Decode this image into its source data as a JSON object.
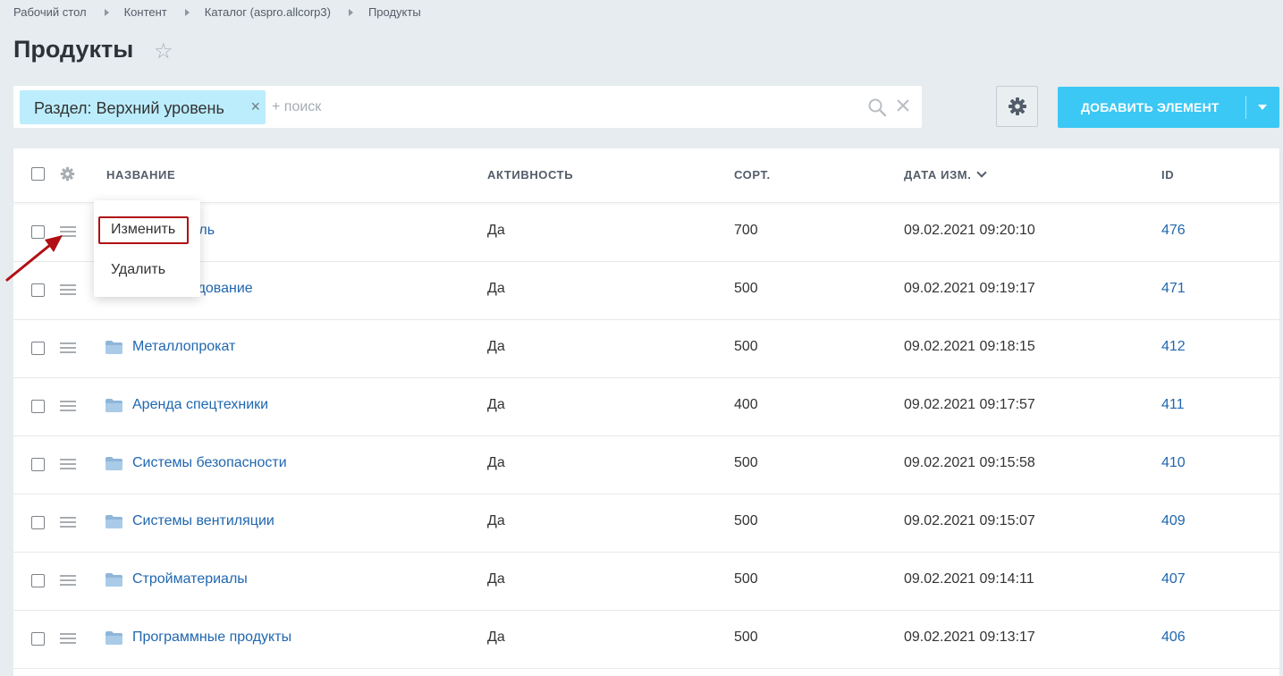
{
  "breadcrumbs": [
    "Рабочий стол",
    "Контент",
    "Каталог (aspro.allcorp3)",
    "Продукты"
  ],
  "page_title": "Продукты",
  "filter": {
    "chip_label": "Раздел: Верхний уровень",
    "search_placeholder": "+ поиск"
  },
  "toolbar": {
    "add_label": "ДОБАВИТЬ ЭЛЕМЕНТ"
  },
  "columns": {
    "name": "НАЗВАНИЕ",
    "active": "АКТИВНОСТЬ",
    "sort": "СОРТ.",
    "date": "ДАТА ИЗМ.",
    "id": "ID"
  },
  "rows": [
    {
      "name": "ская мебель",
      "active": "Да",
      "sort": "700",
      "date": "09.02.2021 09:20:10",
      "id": "476",
      "folder": false
    },
    {
      "name": "кое оборудование",
      "active": "Да",
      "sort": "500",
      "date": "09.02.2021 09:19:17",
      "id": "471",
      "folder": false
    },
    {
      "name": "Металлопрокат",
      "active": "Да",
      "sort": "500",
      "date": "09.02.2021 09:18:15",
      "id": "412",
      "folder": true
    },
    {
      "name": "Аренда спецтехники",
      "active": "Да",
      "sort": "400",
      "date": "09.02.2021 09:17:57",
      "id": "411",
      "folder": true
    },
    {
      "name": "Системы безопасности",
      "active": "Да",
      "sort": "500",
      "date": "09.02.2021 09:15:58",
      "id": "410",
      "folder": true
    },
    {
      "name": "Системы вентиляции",
      "active": "Да",
      "sort": "500",
      "date": "09.02.2021 09:15:07",
      "id": "409",
      "folder": true
    },
    {
      "name": "Стройматериалы",
      "active": "Да",
      "sort": "500",
      "date": "09.02.2021 09:14:11",
      "id": "407",
      "folder": true
    },
    {
      "name": "Программные продукты",
      "active": "Да",
      "sort": "500",
      "date": "09.02.2021 09:13:17",
      "id": "406",
      "folder": true
    }
  ],
  "context_menu": {
    "edit": "Изменить",
    "delete": "Удалить"
  },
  "colors": {
    "accent": "#3bc8f5",
    "chip": "#bcedfc",
    "link": "#2067b0",
    "annotation": "#b00f14"
  }
}
